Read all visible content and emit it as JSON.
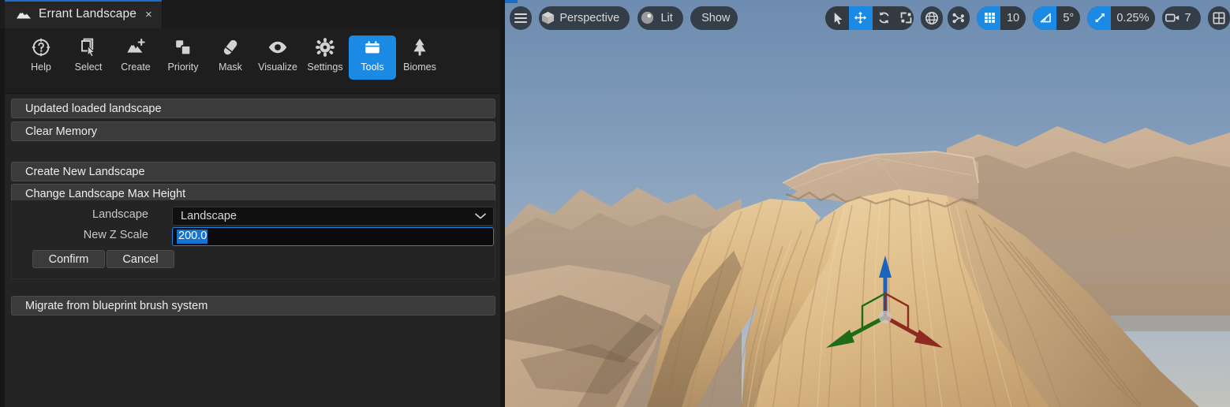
{
  "tab": {
    "icon": "mountain-icon",
    "title": "Errant Landscape",
    "close": "×"
  },
  "modebar": {
    "items": [
      {
        "label": "Help",
        "icon": "question-mark-circle-icon",
        "active": false
      },
      {
        "label": "Select",
        "icon": "cursor-select-icon",
        "active": false
      },
      {
        "label": "Create",
        "icon": "mountain-plus-icon",
        "active": false
      },
      {
        "label": "Priority",
        "icon": "stacked-squares-icon",
        "active": false
      },
      {
        "label": "Mask",
        "icon": "eraser-icon",
        "active": false
      },
      {
        "label": "Visualize",
        "icon": "eye-icon",
        "active": false
      },
      {
        "label": "Settings",
        "icon": "gear-icon",
        "active": false
      },
      {
        "label": "Tools",
        "icon": "toolbox-icon",
        "active": true
      },
      {
        "label": "Biomes",
        "icon": "tree-icon",
        "active": false
      }
    ],
    "active_accent": "#1a8ae5"
  },
  "panel": {
    "status_button": "Updated loaded landscape",
    "clear_memory_button": "Clear Memory",
    "create_new_landscape_button": "Create New Landscape",
    "change_max_height_button": "Change Landscape Max Height",
    "migrate_button": "Migrate from blueprint brush system"
  },
  "form": {
    "landscape_label": "Landscape",
    "landscape_value": "Landscape",
    "landscape_chevron": "⌄",
    "z_scale_label": "New Z Scale",
    "z_scale_value": "200.0",
    "z_scale_selected": true,
    "confirm_button": "Confirm",
    "cancel_button": "Cancel",
    "focus_color": "#1f82e0",
    "selection_color": "#1673d2"
  },
  "viewport": {
    "menu_icon": "hamburger-menu-icon",
    "camera_mode": {
      "label": "Perspective",
      "icon": "cube-icon"
    },
    "view_mode": {
      "label": "Lit",
      "icon": "lit-sphere-icon"
    },
    "show_menu": {
      "label": "Show"
    },
    "transform_tools": [
      {
        "icon": "select-arrow-icon",
        "active": false
      },
      {
        "icon": "move-icon",
        "active": true
      },
      {
        "icon": "rotate-icon",
        "active": false
      },
      {
        "icon": "scale-icon",
        "active": false
      }
    ],
    "coord_space_icon": "globe-icon",
    "surface_snap_icon": "surface-snap-icon",
    "grid_snap": {
      "icon": "grid-icon",
      "value": "10",
      "active": true
    },
    "angle_snap": {
      "icon": "angle-icon",
      "value": "5°",
      "active": true
    },
    "scale_snap": {
      "icon": "diagonal-arrow-icon",
      "value": "0.25%",
      "active": true
    },
    "camera_speed": {
      "icon": "camera-icon",
      "value": "7"
    },
    "layout_icon": "viewport-layout-icon",
    "gizmo": {
      "type": "translate-gizmo",
      "axis_x_color": "#8e2b20",
      "axis_y_color": "#1f6b1a",
      "axis_z_color": "#1c63c0"
    },
    "scene": {
      "description": "3D landscape mesa with flat plateau top",
      "sky_top": "#6e8cb0",
      "sky_bottom": "#c3c3be",
      "terrain_light": "#e4c48f",
      "terrain_mid": "#c9a070",
      "terrain_shadow": "#7d6248",
      "plateau_color": "#c9b198"
    }
  }
}
